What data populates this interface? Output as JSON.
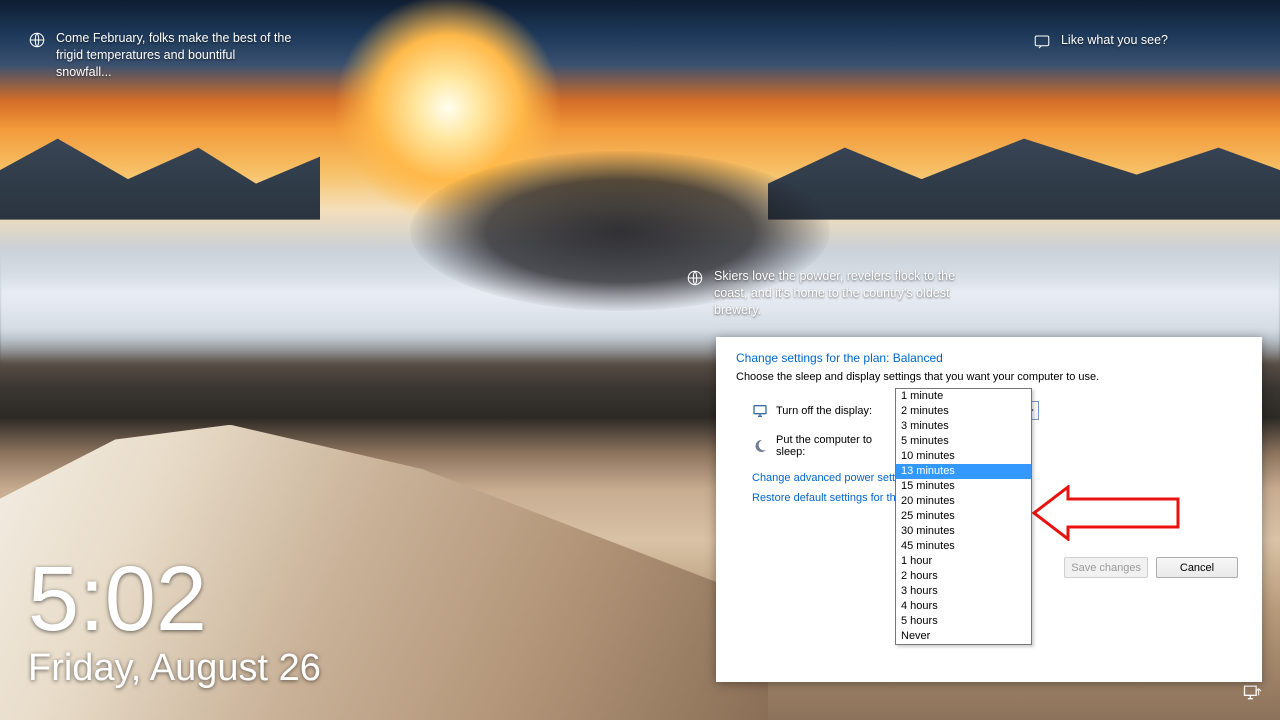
{
  "lockscreen": {
    "time": "5:02",
    "date": "Friday, August 26",
    "spotlight_top_left": "Come February, folks make the best of the frigid temperatures and bountiful snowfall...",
    "spotlight_top_right": "Like what you see?",
    "spotlight_center": "Skiers love the powder, revelers flock to the coast, and it's home to the country's oldest brewery."
  },
  "panel": {
    "title": "Change settings for the plan: Balanced",
    "subtitle": "Choose the sleep and display settings that you want your computer to use.",
    "row_display_label": "Turn off the display:",
    "row_sleep_label": "Put the computer to sleep:",
    "display_value": "13 minutes",
    "link_advanced": "Change advanced power settings",
    "link_restore": "Restore default settings for this plan",
    "save_label": "Save changes",
    "cancel_label": "Cancel",
    "options": [
      "1 minute",
      "2 minutes",
      "3 minutes",
      "5 minutes",
      "10 minutes",
      "13 minutes",
      "15 minutes",
      "20 minutes",
      "25 minutes",
      "30 minutes",
      "45 minutes",
      "1 hour",
      "2 hours",
      "3 hours",
      "4 hours",
      "5 hours",
      "Never"
    ],
    "selected_option": "13 minutes"
  }
}
